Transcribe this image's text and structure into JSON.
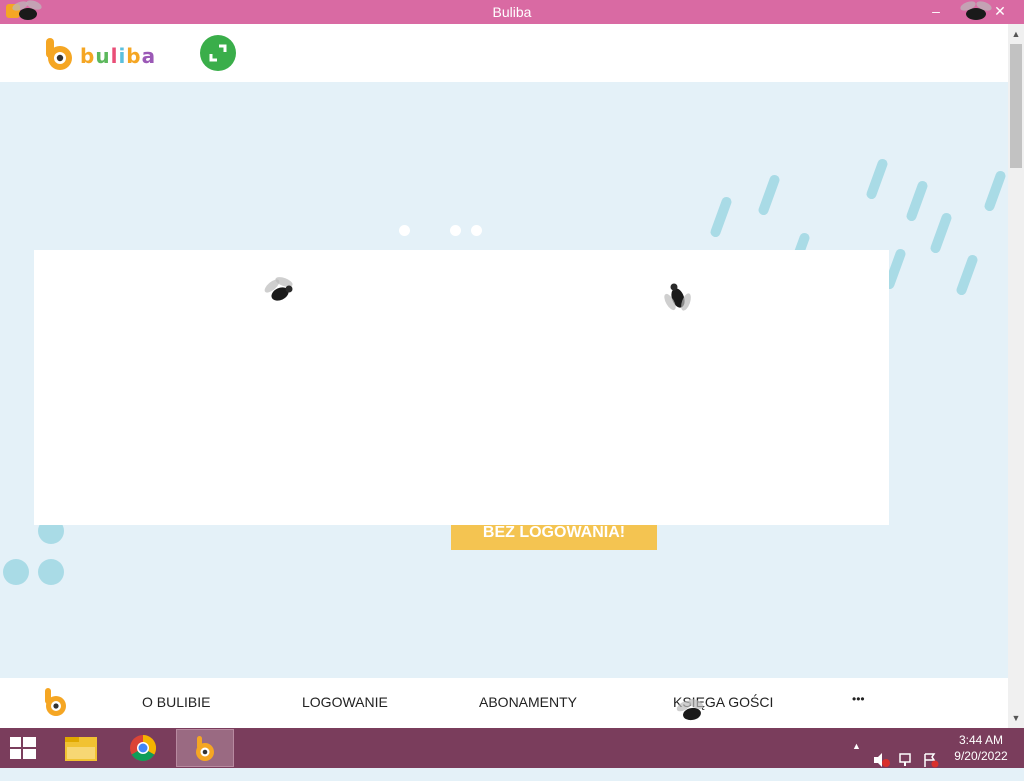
{
  "window": {
    "title": "Buliba",
    "minimize_glyph": "–",
    "close_glyph": "✕"
  },
  "header": {
    "logo_text": "buliba",
    "expand_icon": "expand-icon"
  },
  "hero": {
    "cta_label": "BEZ LOGOWANIA!",
    "slider_dots": 3,
    "colors": {
      "background": "#e4f1f8",
      "accent_dash": "#a9dbe6",
      "cta": "#f4c451"
    }
  },
  "bottom_nav": {
    "items": [
      {
        "label": "O BULIBIE"
      },
      {
        "label": "LOGOWANIE"
      },
      {
        "label": "ABONAMENTY"
      },
      {
        "label": "KSIĘGA GOŚCI"
      }
    ],
    "more_label": "•••"
  },
  "taskbar": {
    "time": "3:44 AM",
    "date": "9/20/2022",
    "tray_arrow": "▲"
  },
  "scrollbar": {
    "up_glyph": "▲",
    "down_glyph": "▼"
  }
}
